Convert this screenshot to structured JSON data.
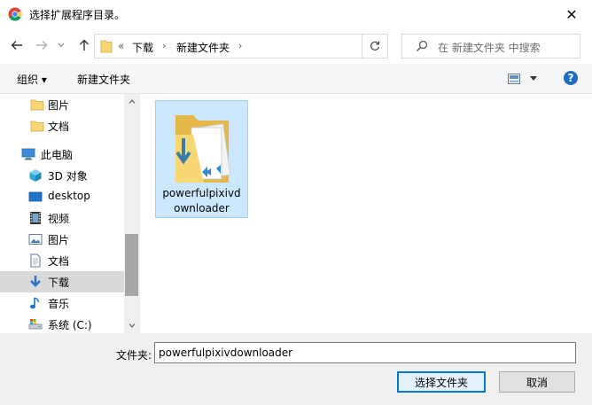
{
  "window": {
    "title": "选择扩展程序目录。",
    "close_glyph": "✕"
  },
  "address": {
    "overflow": "«",
    "crumbs": [
      "下载",
      "新建文件夹"
    ],
    "sep": "›"
  },
  "search": {
    "placeholder": "在 新建文件夹 中搜索"
  },
  "toolbar": {
    "organize": "组织 ▾",
    "new_folder": "新建文件夹",
    "help": "?"
  },
  "sidebar": {
    "items": [
      {
        "label": "图片",
        "icon": "folder-icon"
      },
      {
        "label": "文档",
        "icon": "folder-icon"
      },
      {
        "label": "此电脑",
        "icon": "computer-icon"
      },
      {
        "label": "3D 对象",
        "icon": "cube-icon"
      },
      {
        "label": "desktop",
        "icon": "desktop-icon"
      },
      {
        "label": "视频",
        "icon": "video-icon"
      },
      {
        "label": "图片",
        "icon": "pictures-icon"
      },
      {
        "label": "文档",
        "icon": "documents-icon"
      },
      {
        "label": "下载",
        "icon": "download-icon",
        "selected": true
      },
      {
        "label": "音乐",
        "icon": "music-icon"
      },
      {
        "label": "系统 (C:)",
        "icon": "drive-icon"
      }
    ]
  },
  "content": {
    "items": [
      {
        "name": "powerfulpixivdownloader",
        "icon": "folder-icon"
      }
    ]
  },
  "footer": {
    "folder_label": "文件夹:",
    "folder_value": "powerfulpixivdownloader",
    "select_button": "选择文件夹",
    "cancel_button": "取消"
  },
  "colors": {
    "accent": "#0078d7",
    "selection": "#cce8ff",
    "folder": "#f8d775"
  }
}
